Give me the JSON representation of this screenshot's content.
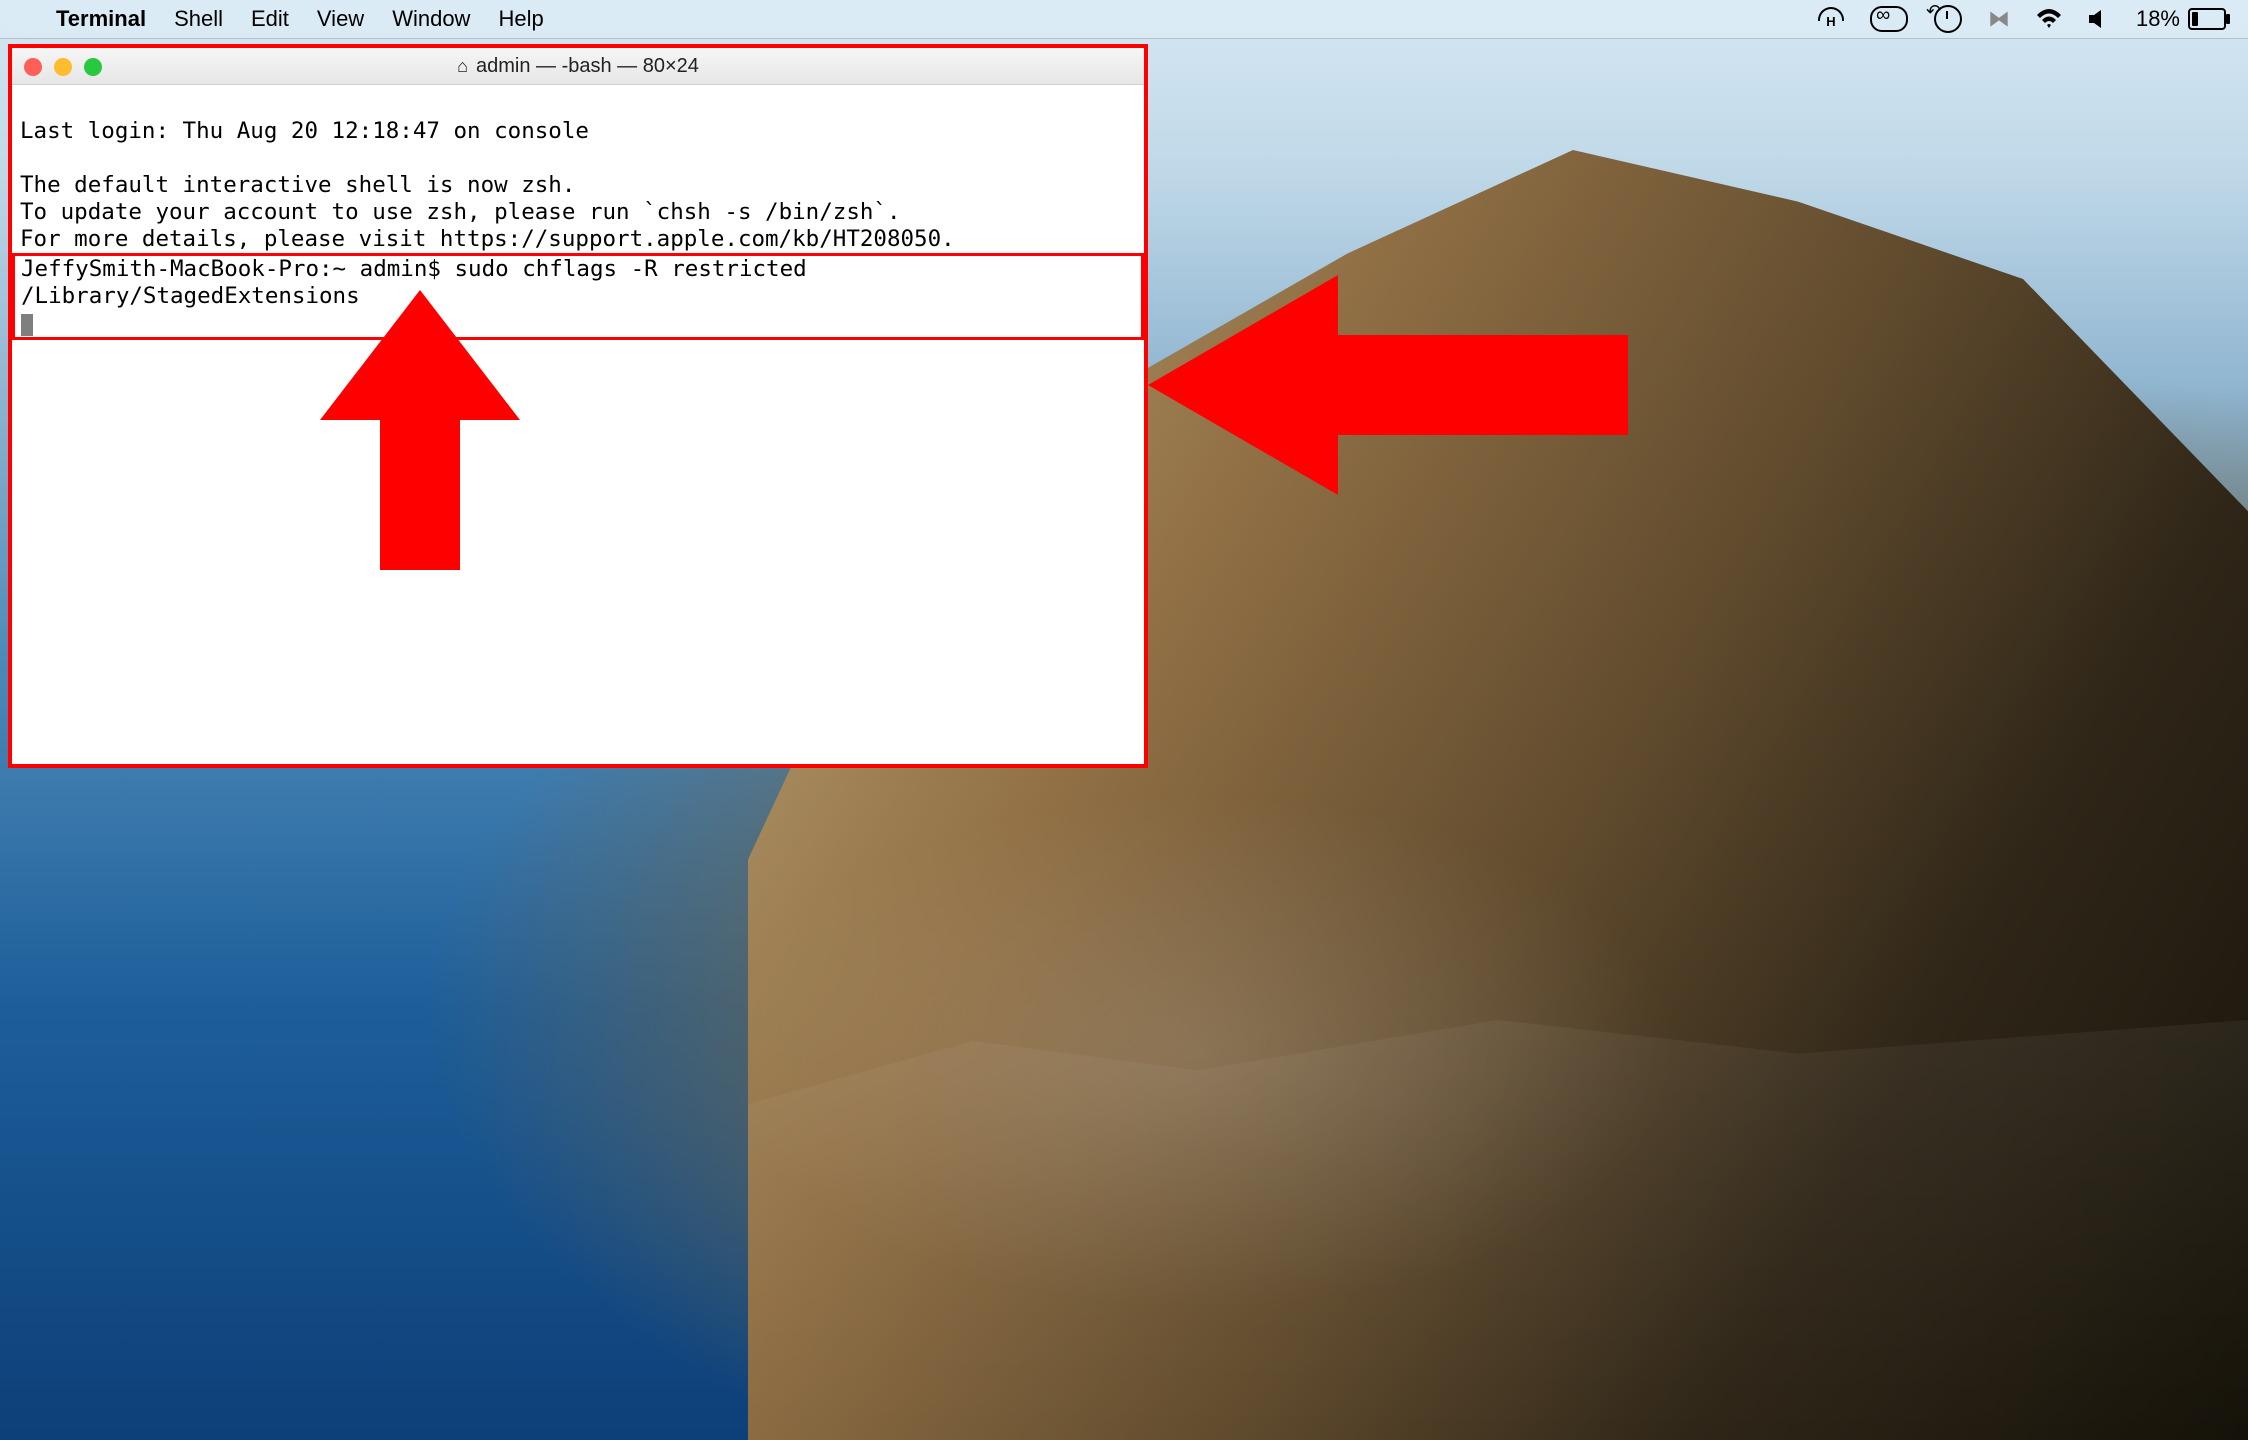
{
  "menubar": {
    "app_name": "Terminal",
    "items": [
      "Shell",
      "Edit",
      "View",
      "Window",
      "Help"
    ],
    "battery_pct": "18%"
  },
  "terminal": {
    "title": "admin — -bash — 80×24",
    "lines": {
      "l1": "Last login: Thu Aug 20 12:18:47 on console",
      "l2": "",
      "l3": "The default interactive shell is now zsh.",
      "l4": "To update your account to use zsh, please run `chsh -s /bin/zsh`.",
      "l5": "For more details, please visit https://support.apple.com/kb/HT208050."
    },
    "prompt": "JeffySmith-MacBook-Pro:~ admin$ ",
    "command": "sudo chflags -R restricted /Library/StagedExtensions"
  },
  "annotations": {
    "window_highlight_color": "#ff0000",
    "arrow_color": "#ff0000"
  }
}
